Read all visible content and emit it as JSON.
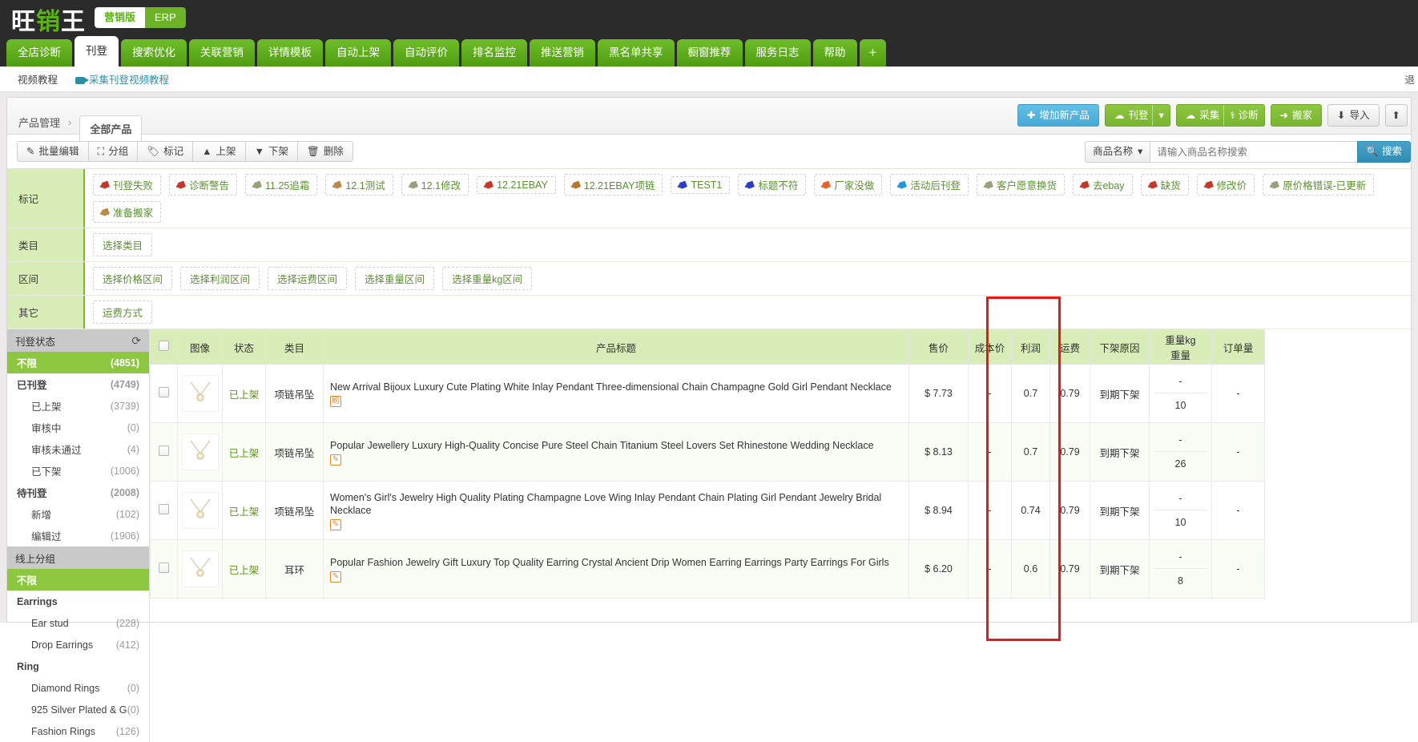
{
  "brand": {
    "char1": "旺",
    "char2": "销",
    "char3": "王",
    "version_on": "营销版",
    "version_off": "ERP"
  },
  "nav": {
    "tabs": [
      {
        "label": "全店诊断",
        "active": false
      },
      {
        "label": "刊登",
        "active": true
      },
      {
        "label": "搜索优化",
        "active": false
      },
      {
        "label": "关联营销",
        "active": false
      },
      {
        "label": "详情模板",
        "active": false
      },
      {
        "label": "自动上架",
        "active": false
      },
      {
        "label": "自动评价",
        "active": false
      },
      {
        "label": "排名监控",
        "active": false
      },
      {
        "label": "推送营销",
        "active": false
      },
      {
        "label": "黑名单共享",
        "active": false
      },
      {
        "label": "橱窗推荐",
        "active": false
      },
      {
        "label": "服务日志",
        "active": false
      },
      {
        "label": "帮助",
        "active": false
      }
    ],
    "add_tab": "+"
  },
  "tutorial": {
    "label": "视频教程",
    "link": "采集刊登视频教程",
    "right_text": "退"
  },
  "breadcrumb": {
    "root": "产品管理",
    "sep": "›",
    "current": "全部产品"
  },
  "actions": {
    "add_product": "增加新产品",
    "publish": "刊登",
    "publish_caret": "▾",
    "collect": "采集",
    "diagnose": "诊断",
    "migrate": "搬家",
    "import": "导入",
    "export_icon": "▲"
  },
  "toolbar": {
    "buttons": [
      {
        "label": "批量编辑",
        "icon": "edit-icon"
      },
      {
        "label": "分组",
        "icon": "group-icon"
      },
      {
        "label": "标记",
        "icon": "tag-icon"
      },
      {
        "label": "上架",
        "icon": "caret-up-icon"
      },
      {
        "label": "下架",
        "icon": "caret-down-icon"
      },
      {
        "label": "删除",
        "icon": "trash-icon"
      }
    ]
  },
  "search": {
    "select_label": "商品名称",
    "caret": "▾",
    "placeholder": "请输入商品名称搜索",
    "button": "搜索"
  },
  "filters": [
    {
      "label": "标记",
      "type": "tags",
      "items": [
        {
          "text": "刊登失败",
          "color": "#c0392b"
        },
        {
          "text": "诊断警告",
          "color": "#c0392b"
        },
        {
          "text": "11.25追霜",
          "color": "#9aa07a"
        },
        {
          "text": "12.1测试",
          "color": "#b98a46"
        },
        {
          "text": "12.1修改",
          "color": "#9aa07a"
        },
        {
          "text": "12.21EBAY",
          "color": "#c0392b"
        },
        {
          "text": "12.21EBAY项链",
          "color": "#b9732a"
        },
        {
          "text": "TEST1",
          "color": "#2b3fc0"
        },
        {
          "text": "标题不符",
          "color": "#2b3fc0"
        },
        {
          "text": "厂家没做",
          "color": "#e8612c"
        },
        {
          "text": "活动后刊登",
          "color": "#2196d6"
        },
        {
          "text": "客户愿意换货",
          "color": "#9aa07a"
        },
        {
          "text": "去ebay",
          "color": "#c0392b"
        },
        {
          "text": "缺货",
          "color": "#c0392b"
        },
        {
          "text": "修改价",
          "color": "#c0392b"
        },
        {
          "text": "原价格错误-已更新",
          "color": "#9aa07a"
        },
        {
          "text": "准备搬家",
          "color": "#b98a46"
        }
      ]
    },
    {
      "label": "类目",
      "type": "select",
      "items": [
        {
          "text": "选择类目"
        }
      ]
    },
    {
      "label": "区间",
      "type": "select",
      "items": [
        {
          "text": "选择价格区间"
        },
        {
          "text": "选择利润区间"
        },
        {
          "text": "选择运费区间"
        },
        {
          "text": "选择重量区间"
        },
        {
          "text": "选择重量kg区间"
        }
      ]
    },
    {
      "label": "其它",
      "type": "select",
      "items": [
        {
          "text": "运费方式"
        }
      ]
    }
  ],
  "sidebar": {
    "sections": [
      {
        "header": "刊登状态",
        "refresh_icon": "refresh-icon",
        "items": [
          {
            "label": "不限",
            "count": "(4851)",
            "level": 0,
            "selected": true
          },
          {
            "label": "已刊登",
            "count": "(4749)",
            "level": 0,
            "selected": false
          },
          {
            "label": "已上架",
            "count": "(3739)",
            "level": 1,
            "selected": false
          },
          {
            "label": "审核中",
            "count": "(0)",
            "level": 1,
            "selected": false
          },
          {
            "label": "审核未通过",
            "count": "(4)",
            "level": 1,
            "selected": false
          },
          {
            "label": "已下架",
            "count": "(1006)",
            "level": 1,
            "selected": false
          },
          {
            "label": "待刊登",
            "count": "(2008)",
            "level": 0,
            "selected": false
          },
          {
            "label": "新增",
            "count": "(102)",
            "level": 1,
            "selected": false
          },
          {
            "label": "编辑过",
            "count": "(1906)",
            "level": 1,
            "selected": false
          }
        ]
      },
      {
        "header": "线上分组",
        "refresh_icon": "",
        "items": [
          {
            "label": "不限",
            "count": "",
            "level": 0,
            "selected": true
          },
          {
            "label": "Earrings",
            "count": "",
            "level": 0,
            "selected": false
          },
          {
            "label": "Ear stud",
            "count": "(228)",
            "level": 1,
            "selected": false
          },
          {
            "label": "Drop Earrings",
            "count": "(412)",
            "level": 1,
            "selected": false
          },
          {
            "label": "Ring",
            "count": "",
            "level": 0,
            "selected": false
          },
          {
            "label": "Diamond Rings",
            "count": "(0)",
            "level": 1,
            "selected": false
          },
          {
            "label": "925 Silver Plated & G",
            "count": "(0)",
            "level": 1,
            "selected": false
          },
          {
            "label": "Fashion Rings",
            "count": "(126)",
            "level": 1,
            "selected": false
          }
        ]
      }
    ]
  },
  "table": {
    "columns": [
      {
        "key": "chk",
        "label": ""
      },
      {
        "key": "img",
        "label": "图像"
      },
      {
        "key": "status",
        "label": "状态"
      },
      {
        "key": "category",
        "label": "类目"
      },
      {
        "key": "title",
        "label": "产品标题"
      },
      {
        "key": "price",
        "label": "售价"
      },
      {
        "key": "cost",
        "label": "成本价"
      },
      {
        "key": "profit",
        "label": "利润"
      },
      {
        "key": "shipping",
        "label": "运费"
      },
      {
        "key": "expire",
        "label": "下架原因"
      },
      {
        "key": "weight",
        "label_top": "重量kg",
        "label_bottom": "重量"
      },
      {
        "key": "orders",
        "label": "订单量"
      }
    ],
    "rows": [
      {
        "status": "已上架",
        "category": "项链吊坠",
        "title": "New Arrival Bijoux Luxury Cute Plating White Inlay Pendant Three-dimensional Chain Champagne Gold Girl Pendant Necklace",
        "edit_badge": "刷",
        "price": "$ 7.73",
        "cost": "-",
        "profit": "0.7",
        "shipping": "0.79",
        "expire": "到期下架",
        "weight_kg": "-",
        "weight": "10",
        "orders": "-"
      },
      {
        "status": "已上架",
        "category": "项链吊坠",
        "title": "Popular Jewellery Luxury High-Quality Concise Pure Steel Chain Titanium Steel Lovers Set Rhinestone Wedding Necklace",
        "edit_badge": "✎",
        "price": "$ 8.13",
        "cost": "-",
        "profit": "0.7",
        "shipping": "0.79",
        "expire": "到期下架",
        "weight_kg": "-",
        "weight": "26",
        "orders": "-"
      },
      {
        "status": "已上架",
        "category": "项链吊坠",
        "title": "Women's Girl's Jewelry High Quality Plating Champagne Love Wing Inlay Pendant Chain Plating Girl Pendant Jewelry Bridal Necklace",
        "edit_badge": "✎",
        "price": "$ 8.94",
        "cost": "-",
        "profit": "0.74",
        "shipping": "0.79",
        "expire": "到期下架",
        "weight_kg": "-",
        "weight": "10",
        "orders": "-"
      },
      {
        "status": "已上架",
        "category": "耳环",
        "title": "Popular Fashion Jewelry Gift Luxury Top Quality Earring Crystal Ancient Drip Women Earring Earrings Party Earrings For Girls",
        "edit_badge": "✎",
        "price": "$ 6.20",
        "cost": "-",
        "profit": "0.6",
        "shipping": "0.79",
        "expire": "到期下架",
        "weight_kg": "-",
        "weight": "8",
        "orders": "-"
      }
    ]
  },
  "highlight": {
    "color": "#f01414"
  }
}
